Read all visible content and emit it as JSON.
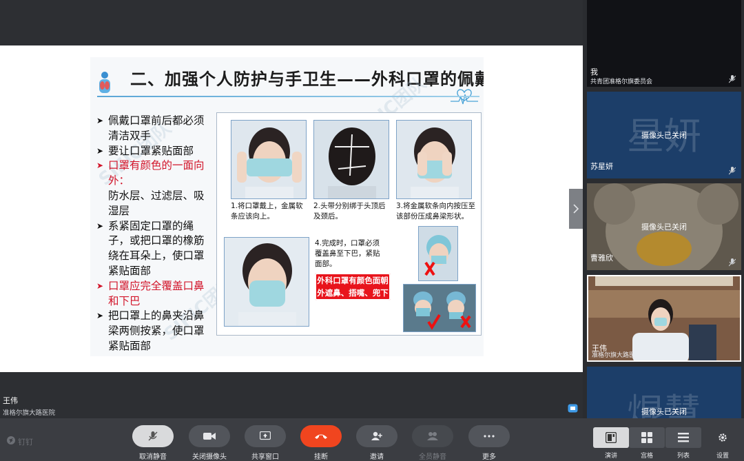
{
  "slide": {
    "title": "二、加强个人防护与手卫生——外科口罩的佩戴",
    "watermark": "SIFIC团队",
    "bullets": [
      {
        "text": "佩戴口罩前后都必须清洁双手",
        "highlight": false
      },
      {
        "text": "要让口罩紧贴面部",
        "highlight": false
      },
      {
        "text": "口罩有颜色的一面向外：",
        "highlight": true
      },
      {
        "text": "防水层、过滤层、吸湿层",
        "highlight": false,
        "continuation": true
      },
      {
        "text": "系紧固定口罩的绳子，或把口罩的橡筋绕在耳朵上，使口罩紧贴面部",
        "highlight": false
      },
      {
        "text": "口罩应完全覆盖口鼻和下巴",
        "highlight": true
      },
      {
        "text": "把口罩上的鼻夹沿鼻梁两侧按紧，使口罩紧贴面部",
        "highlight": false
      }
    ],
    "captions": [
      "1.将口罩戴上，金属软条应该向上。",
      "2.头带分别绑于头顶后及颈后。",
      "3.将金属软条向内按压至该部份压成鼻梁形状。",
      "4.完成时，口罩必须覆盖鼻至下巴，紧贴面部。"
    ],
    "banner": "外科口罩有颜色面朝外遮鼻、捂嘴、兜下巴"
  },
  "speaker": {
    "name": "王伟",
    "org": "准格尔旗大路医院"
  },
  "participants": [
    {
      "name": "我",
      "org": "共青团准格尔旗委员会",
      "camera": "",
      "bigname": "",
      "bg": "#111216"
    },
    {
      "name": "苏星妍",
      "org": "",
      "camera": "摄像头已关闭",
      "bigname": "星妍",
      "bg": "#1c3e69"
    },
    {
      "name": "曹雅欣",
      "org": "",
      "camera": "摄像头已关闭",
      "bigname": "",
      "bg": "#7f7566"
    },
    {
      "name": "王伟",
      "org": "准格尔旗大路医",
      "camera": "",
      "bigname": "",
      "bg": "#8a6a52"
    },
    {
      "name": "",
      "org": "",
      "camera": "摄像头已关闭",
      "bigname": "焜慧",
      "bg": "#1c3e69"
    }
  ],
  "toolbar": {
    "brand": "钉钉",
    "unmute": "取消静音",
    "camera_off": "关闭摄像头",
    "share_window": "共享窗口",
    "hangup": "挂断",
    "invite": "邀请",
    "mute_all": "全员静音",
    "more": "更多",
    "view_speaker": "演讲",
    "view_grid": "宫格",
    "view_list": "列表",
    "settings": "设置"
  },
  "colors": {
    "hangup": "#f0451f",
    "highlight": "#d2152a",
    "tile": "#1c3e69"
  }
}
